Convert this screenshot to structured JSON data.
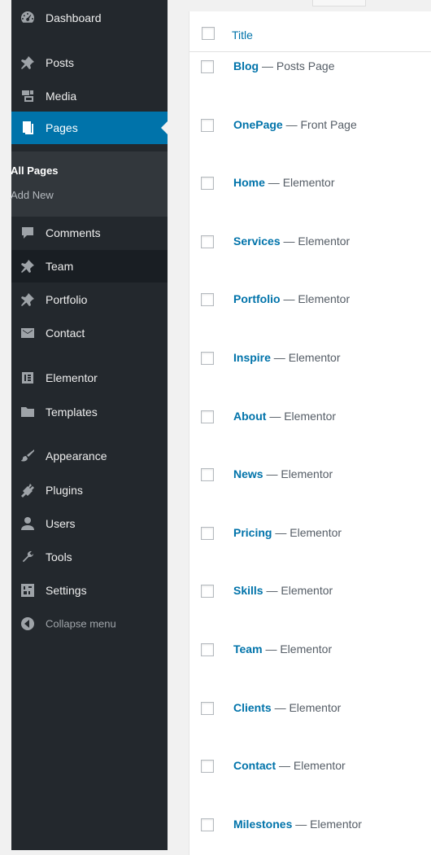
{
  "sidebar": {
    "items": [
      {
        "key": "dashboard",
        "label": "Dashboard",
        "icon": "dashboard-icon"
      },
      {
        "key": "posts",
        "label": "Posts",
        "icon": "pin-icon"
      },
      {
        "key": "media",
        "label": "Media",
        "icon": "media-icon"
      },
      {
        "key": "pages",
        "label": "Pages",
        "icon": "pages-icon"
      },
      {
        "key": "comments",
        "label": "Comments",
        "icon": "comment-icon"
      },
      {
        "key": "team",
        "label": "Team",
        "icon": "pin-icon"
      },
      {
        "key": "portfolio",
        "label": "Portfolio",
        "icon": "pin-icon"
      },
      {
        "key": "contact",
        "label": "Contact",
        "icon": "envelope-icon"
      },
      {
        "key": "elementor",
        "label": "Elementor",
        "icon": "elementor-icon"
      },
      {
        "key": "templates",
        "label": "Templates",
        "icon": "folder-icon"
      },
      {
        "key": "appearance",
        "label": "Appearance",
        "icon": "paintbrush-icon"
      },
      {
        "key": "plugins",
        "label": "Plugins",
        "icon": "plug-icon"
      },
      {
        "key": "users",
        "label": "Users",
        "icon": "user-icon"
      },
      {
        "key": "tools",
        "label": "Tools",
        "icon": "wrench-icon"
      },
      {
        "key": "settings",
        "label": "Settings",
        "icon": "settings-icon"
      },
      {
        "key": "collapse",
        "label": "Collapse menu",
        "icon": "collapse-icon"
      }
    ],
    "submenu": {
      "all_pages": "All Pages",
      "add_new": "Add New"
    }
  },
  "table": {
    "column_title": "Title",
    "separator": "—",
    "rows": [
      {
        "title": "Blog",
        "state": "Posts Page"
      },
      {
        "title": "OnePage",
        "state": "Front Page"
      },
      {
        "title": "Home",
        "state": "Elementor"
      },
      {
        "title": "Services",
        "state": "Elementor"
      },
      {
        "title": "Portfolio",
        "state": "Elementor"
      },
      {
        "title": "Inspire",
        "state": "Elementor"
      },
      {
        "title": "About",
        "state": "Elementor"
      },
      {
        "title": "News",
        "state": "Elementor"
      },
      {
        "title": "Pricing",
        "state": "Elementor"
      },
      {
        "title": "Skills",
        "state": "Elementor"
      },
      {
        "title": "Team",
        "state": "Elementor"
      },
      {
        "title": "Clients",
        "state": "Elementor"
      },
      {
        "title": "Contact",
        "state": "Elementor"
      },
      {
        "title": "Milestones",
        "state": "Elementor"
      }
    ]
  },
  "colors": {
    "sidebar_bg": "#23282d",
    "submenu_bg": "#32373c",
    "accent": "#0073aa",
    "link": "#0073aa"
  }
}
